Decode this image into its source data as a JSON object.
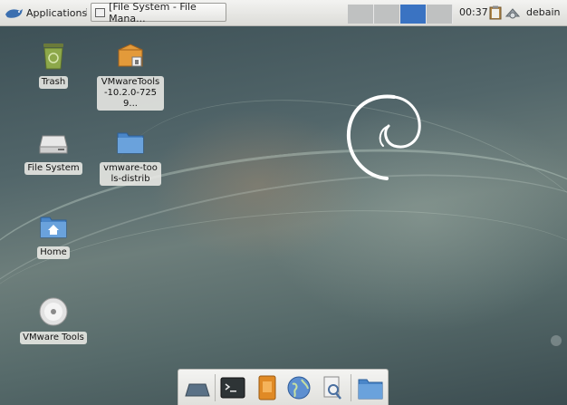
{
  "panel": {
    "applications_label": "Applications",
    "task_title": "[File System - File Mana...",
    "workspaces": [
      {
        "active": false
      },
      {
        "active": false
      },
      {
        "active": true
      },
      {
        "active": false
      }
    ],
    "clock": "00:37",
    "user": "debain"
  },
  "desktop_icons": [
    {
      "label": "Trash",
      "icon": "trash-icon"
    },
    {
      "label": "VMwareTools-10.2.0-7259...",
      "icon": "package-icon"
    },
    {
      "label": "File System",
      "icon": "drive-icon"
    },
    {
      "label": "vmware-tools-distrib",
      "icon": "folder-icon"
    },
    {
      "label": "Home",
      "icon": "home-folder-icon"
    },
    {
      "label": "VMware Tools",
      "icon": "disc-icon"
    }
  ],
  "dock": [
    "show-desktop-icon",
    "terminal-icon",
    "file-manager-icon",
    "web-browser-icon",
    "app-finder-icon",
    "folder-icon"
  ],
  "colors": {
    "panel": "#e7e7e4",
    "active_workspace": "#3a73c2"
  }
}
